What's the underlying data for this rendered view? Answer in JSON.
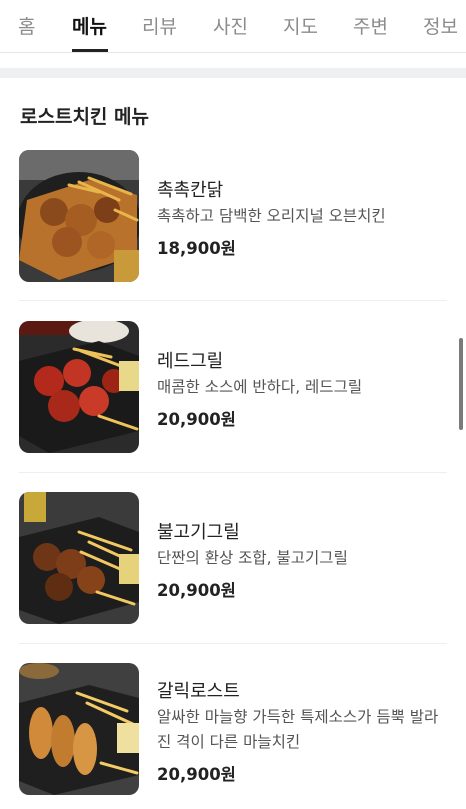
{
  "tabs": [
    {
      "label": "홈"
    },
    {
      "label": "메뉴"
    },
    {
      "label": "리뷰"
    },
    {
      "label": "사진"
    },
    {
      "label": "지도"
    },
    {
      "label": "주변"
    },
    {
      "label": "정보"
    }
  ],
  "active_tab": "메뉴",
  "section": {
    "title": "로스트치킨 메뉴"
  },
  "menu": [
    {
      "name": "촉촉칸닭",
      "description": "촉촉하고 담백한 오리지널 오븐치킨",
      "price": "18,900원",
      "photo_icon": "roast-chicken-photo"
    },
    {
      "name": "레드그릴",
      "description": "매콤한 소스에 반하다, 레드그릴",
      "price": "20,900원",
      "photo_icon": "red-grill-chicken-photo"
    },
    {
      "name": "불고기그릴",
      "description": "단짠의 환상 조합, 불고기그릴",
      "price": "20,900원",
      "photo_icon": "bulgogi-grill-chicken-photo"
    },
    {
      "name": "갈릭로스트",
      "description": "알싸한 마늘향 가득한 특제소스가 듬뿍 발라진 격이 다른 마늘치킨",
      "price": "20,900원",
      "photo_icon": "garlic-roast-chicken-photo"
    }
  ],
  "colors": {
    "active_tab": "#111111",
    "inactive_tab": "#8c8c8c",
    "section_gap": "#eef0f2",
    "divider": "#eeeeee"
  }
}
